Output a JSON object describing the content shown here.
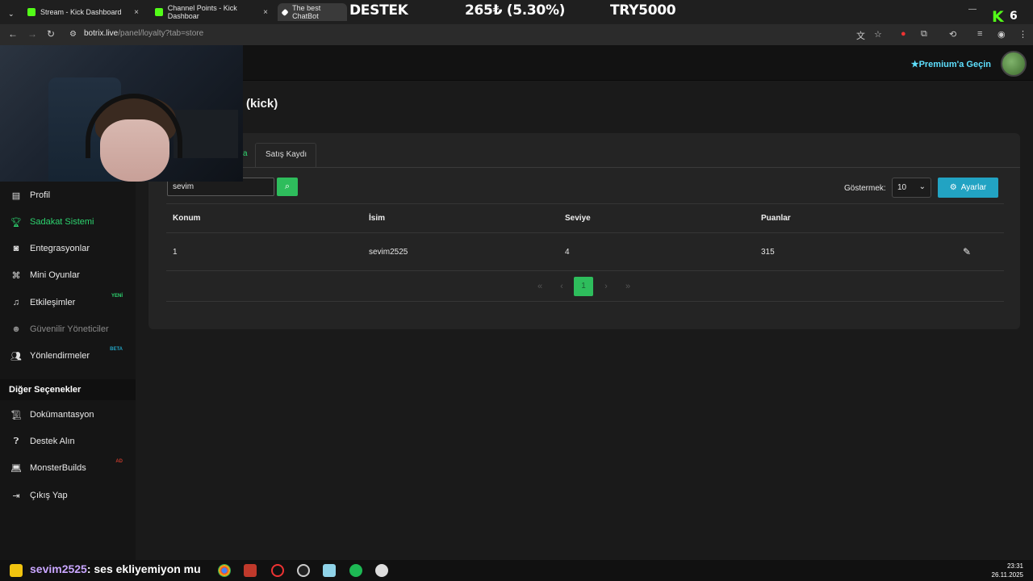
{
  "browser": {
    "tabs": [
      {
        "title": "Stream - Kick Dashboard",
        "close": "×"
      },
      {
        "title": "Channel Points - Kick Dashboar",
        "close": "×"
      },
      {
        "title": "The best ChatBot"
      }
    ],
    "url_host": "botrix.live",
    "url_path": "/panel/loyalty?tab=store"
  },
  "stream_overlay": {
    "ticker_1": "DESTEK",
    "ticker_2": "265₺ (5.30%)",
    "ticker_3": "TRY5000",
    "kick_logo": "K",
    "kick_count": "6"
  },
  "header": {
    "premium_label": "Premium'a Geçin"
  },
  "page": {
    "title": "(kick)"
  },
  "sidebar": {
    "items": [
      {
        "label": "Profil",
        "icon": "id-card-icon"
      },
      {
        "label": "Sadakat Sistemi",
        "icon": "trophy-icon"
      },
      {
        "label": "Entegrasyonlar",
        "icon": "integrations-icon"
      },
      {
        "label": "Mini Oyunlar",
        "icon": "gamepad-icon"
      },
      {
        "label": "Etkileşimler",
        "icon": "music-icon",
        "tag": "YENİ"
      },
      {
        "label": "Güvenilir Yöneticiler",
        "icon": "users-cog-icon"
      },
      {
        "label": "Yönlendirmeler",
        "icon": "users-icon",
        "tag": "BETA"
      }
    ],
    "section_title": "Diğer Seçenekler",
    "other_items": [
      {
        "label": "Dokümantasyon",
        "icon": "scroll-icon"
      },
      {
        "label": "Destek Alın",
        "icon": "question-icon"
      },
      {
        "label": "MonsterBuilds",
        "icon": "laptop-icon",
        "tag": "AD"
      },
      {
        "label": "Çıkış Yap",
        "icon": "sign-out-icon"
      }
    ]
  },
  "tabs": {
    "store_partial": "a",
    "sales": "Satış Kaydı"
  },
  "controls": {
    "search_value": "sevim",
    "show_label": "Göstermek:",
    "show_value": "10",
    "settings_label": "Ayarlar"
  },
  "table": {
    "headers": [
      "Konum",
      "İsim",
      "Seviye",
      "Puanlar"
    ],
    "rows": [
      {
        "rank": "1",
        "name": "sevim2525",
        "level": "4",
        "points": "315"
      }
    ]
  },
  "pagination": {
    "first": "«",
    "prev": "‹",
    "current": "1",
    "next": "›",
    "last": "»"
  },
  "chat": {
    "user": "sevim2525",
    "message": ": ses ekliyemiyon mu"
  },
  "clock": {
    "time": "23:31",
    "date": "26.11.2025"
  },
  "colors": {
    "accent_green": "#2ebd5c",
    "settings_blue": "#22a3c3",
    "premium_cyan": "#5ee0ff"
  }
}
